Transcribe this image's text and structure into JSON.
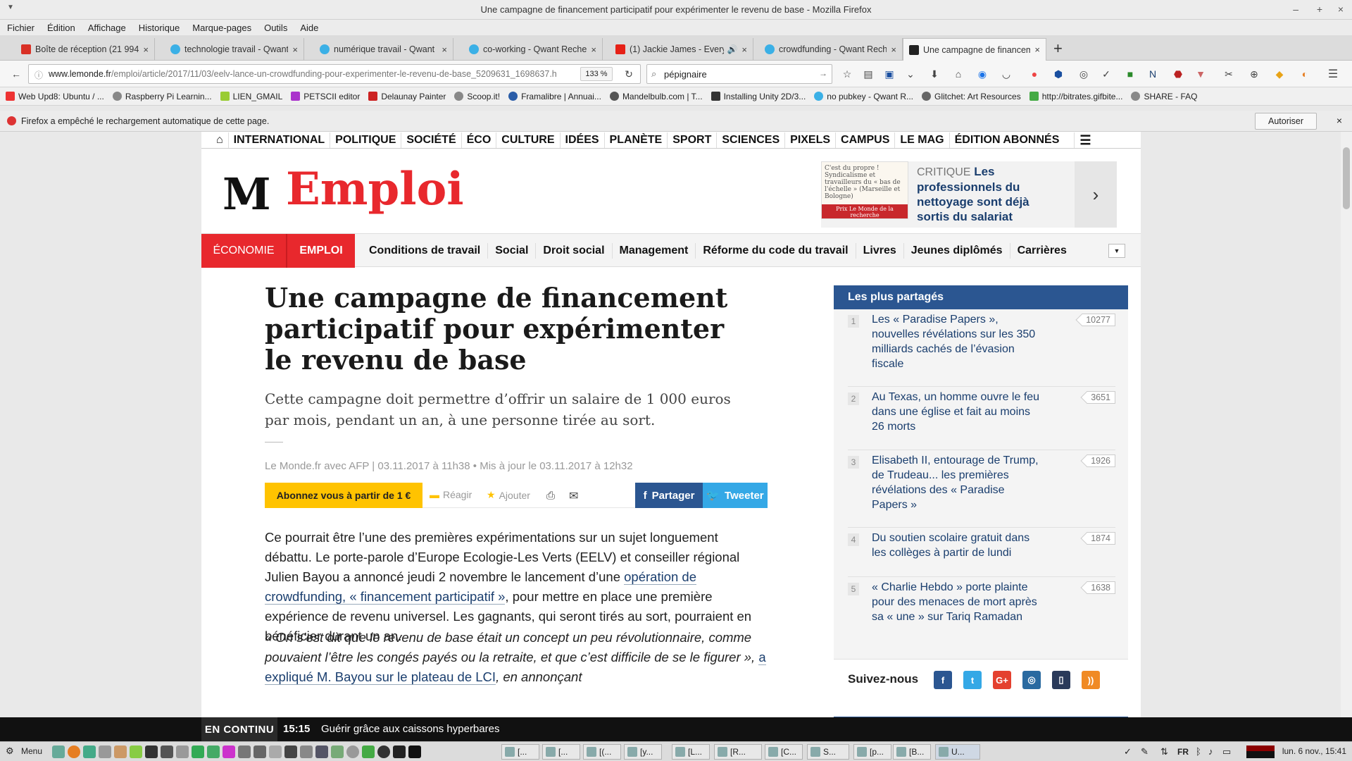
{
  "window": {
    "title": "Une campagne de financement participatif pour expérimenter le revenu de base - Mozilla Firefox"
  },
  "menu": [
    "Fichier",
    "Édition",
    "Affichage",
    "Historique",
    "Marque-pages",
    "Outils",
    "Aide"
  ],
  "tabs": [
    {
      "label": "Boîte de réception (21 994)",
      "color": "#d93025"
    },
    {
      "label": "technologie travail - Qwant",
      "color": "#3bb0e6"
    },
    {
      "label": "numérique travail - Qwant",
      "color": "#3bb0e6"
    },
    {
      "label": "co-working - Qwant Recher",
      "color": "#3bb0e6"
    },
    {
      "label": "(1) Jackie James - Every",
      "color": "#e62117"
    },
    {
      "label": "crowdfunding - Qwant Rech",
      "color": "#3bb0e6"
    },
    {
      "label": "Une campagne de financem",
      "color": "#222222"
    }
  ],
  "nav": {
    "url_host": "www.lemonde.fr",
    "url_path": "/emploi/article/2017/11/03/eelv-lance-un-crowdfunding-pour-experimenter-le-revenu-de-base_5209631_1698637.h",
    "zoom": "133 %",
    "search_value": "pépignaire"
  },
  "bookmarks": [
    "Web Upd8: Ubuntu / ...",
    "Raspberry Pi Learnin...",
    "LIEN_GMAIL",
    "PETSCII editor",
    "Delaunay Painter",
    "Scoop.it!",
    "Framalibre | Annuai...",
    "Mandelbulb.com | T...",
    "Installing Unity 2D/3...",
    "no pubkey - Qwant R...",
    "Glitchet: Art Resources",
    "http://bitrates.gifbite...",
    "SHARE - FAQ"
  ],
  "notification": {
    "text": "Firefox a empêché le rechargement automatique de cette page.",
    "button": "Autoriser"
  },
  "site": {
    "topnav": [
      "INTERNATIONAL",
      "POLITIQUE",
      "SOCIÉTÉ",
      "ÉCO",
      "CULTURE",
      "IDÉES",
      "PLANÈTE",
      "SPORT",
      "SCIENCES",
      "PIXELS",
      "CAMPUS",
      "LE MAG",
      "ÉDITION ABONNÉS"
    ],
    "logo_letter": "M",
    "logo_section": "Emploi",
    "promo": {
      "kicker": "CRITIQUE",
      "title": "Les professionnels du nettoyage sont déjà sortis du salariat",
      "img_text": "C'est du propre ! Syndicalisme et travailleurs du « bas de l'échelle » (Marseille et Bologne)",
      "img_band": "Prix Le Monde de la recherche"
    },
    "section_red": [
      "ÉCONOMIE",
      "EMPLOI"
    ],
    "section_items": [
      "Conditions de travail",
      "Social",
      "Droit social",
      "Management",
      "Réforme du code du travail",
      "Livres",
      "Jeunes diplômés",
      "Carrières"
    ],
    "article": {
      "headline": "Une campagne de financement participatif pour expérimenter le revenu de base",
      "chapo": "Cette campagne doit permettre d’offrir un salaire de 1 000 euros par mois, pendant un an, à une personne tirée au sort.",
      "byline": "Le Monde.fr avec AFP | 03.11.2017 à 11h38 • Mis à jour le 03.11.2017 à 12h32",
      "subscribe": "Abonnez vous à partir de 1 €",
      "reagir": "Réagir",
      "ajouter": "Ajouter",
      "partager": "Partager",
      "tweeter": "Tweeter",
      "p1_a": "Ce pourrait être l’une des premières expérimentations sur un sujet longuement débattu. Le porte-parole d’Europe Ecologie-Les Verts (EELV) et conseiller régional Julien Bayou a annoncé jeudi 2 novembre le lancement d’une ",
      "p1_link": "opération de crowdfunding, « financement participatif »",
      "p1_b": ", pour mettre en place une première expérience de revenu universel. Les gagnants, qui seront tirés au sort, pourraient en bénéficier durant un an.",
      "p2_a": "« On s’est dit que le revenu de base était un concept un peu révolutionnaire, comme pouvaient l’être les congés payés ou la retraite, et que c’est difficile de se le figurer », ",
      "p2_link": "a expliqué M. Bayou sur le plateau de LCI",
      "p2_b": ", en annonçant"
    },
    "sidebar": {
      "title": "Les plus partagés",
      "items": [
        {
          "num": "1",
          "text": "Les « Paradise Papers », nouvelles révélations sur les 350 milliards cachés de l’évasion fiscale",
          "count": "10277"
        },
        {
          "num": "2",
          "text": "Au Texas, un homme ouvre le feu dans une église et fait au moins 26 morts",
          "count": "3651"
        },
        {
          "num": "3",
          "text": "Elisabeth II, entourage de Trump, de Trudeau... les premières révélations des « Paradise Papers »",
          "count": "1926"
        },
        {
          "num": "4",
          "text": "Du soutien scolaire gratuit dans les collèges à partir de lundi",
          "count": "1874"
        },
        {
          "num": "5",
          "text": "« Charlie Hebdo » porte plainte pour des menaces de mort après sa « une » sur Tariq Ramadan",
          "count": "1638"
        }
      ],
      "follow": "Suivez-nous"
    }
  },
  "ticker": {
    "label": "EN CONTINU",
    "time": "15:15",
    "text": "Guérir grâce aux caissons hyperbares"
  },
  "taskbar": {
    "menu": "Menu",
    "lang": "FR",
    "clock": "lun. 6 nov., 15:41",
    "tasks": [
      "[...",
      "[...",
      "[(...",
      "[y...",
      "[L...",
      "[R...",
      "[C...",
      "S...",
      "[p...",
      "[B...",
      "U..."
    ]
  },
  "colors": {
    "lemonde_red": "#e8282d",
    "lemonde_blue": "#2b5691",
    "subscribe_yellow": "#ffc300",
    "twitter": "#34a8e6"
  }
}
